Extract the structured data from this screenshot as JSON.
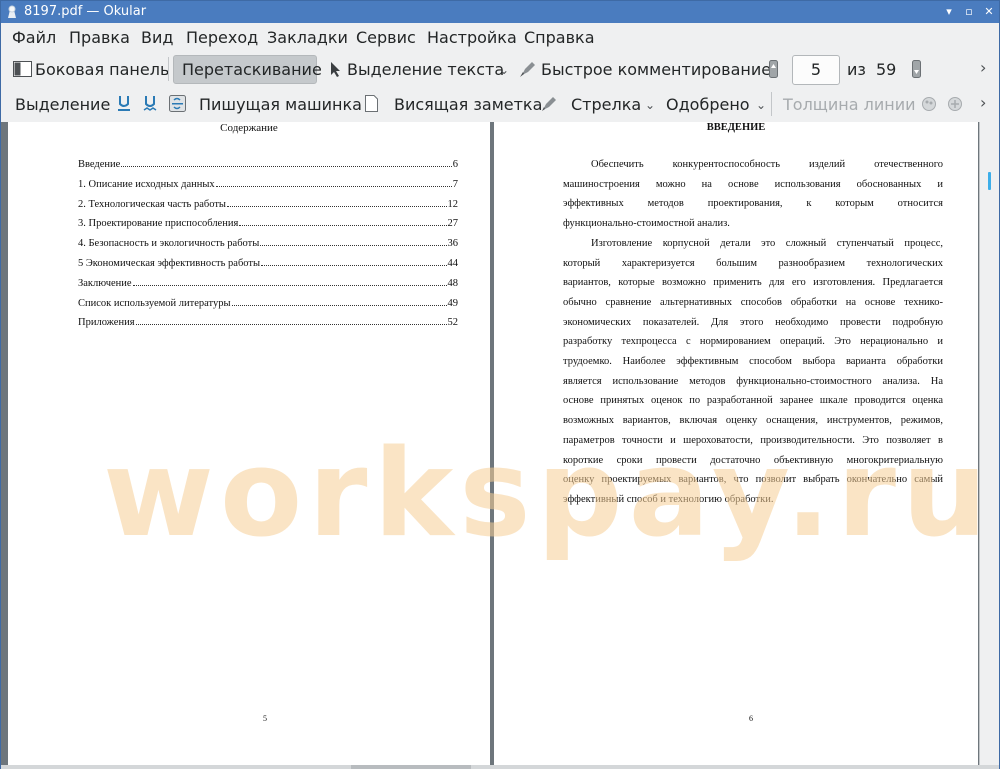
{
  "window": {
    "title": "8197.pdf  — Okular",
    "btn_minimize": "▾",
    "btn_maximize": "▫",
    "btn_close": "✕"
  },
  "menu": [
    "Файл",
    "Правка",
    "Вид",
    "Переход",
    "Закладки",
    "Сервис",
    "Настройка",
    "Справка"
  ],
  "toolbar1": {
    "sidebar": "Боковая панель",
    "drag": "Перетаскивание",
    "text_select": "Выделение текста",
    "quick_annot": "Быстрое комментирование",
    "page_current": "5",
    "page_of": "из",
    "page_total": "59"
  },
  "toolbar2": {
    "select": "Выделение",
    "typewriter": "Пишущая машинка",
    "hanging_note": "Висящая заметка",
    "arrow": "Стрелка",
    "approved": "Одобрено",
    "line_width": "Толщина линии"
  },
  "left_page": {
    "title": "Содержание",
    "toc": [
      {
        "label": "Введение",
        "page": "6"
      },
      {
        "label": "1. Описание  исходных данных",
        "page": "7"
      },
      {
        "label": "2. Технологическая часть работы",
        "page": "12"
      },
      {
        "label": "3. Проектирование приспособления",
        "page": "27"
      },
      {
        "label": "4. Безопасность и экологичность работы",
        "page": "36"
      },
      {
        "label": "5 Экономическая эффективность работы",
        "page": "44"
      },
      {
        "label": "Заключение",
        "page": "48"
      },
      {
        "label": "Список используемой литературы",
        "page": "49"
      },
      {
        "label": "Приложения",
        "page": "52"
      }
    ],
    "page_number": "5"
  },
  "right_page": {
    "title": "ВВЕДЕНИЕ",
    "lines": [
      "Обеспечить      конкурентоспособность      изделий      отечественного",
      "машиностроения можно на основе использования обоснованных и",
      "эффективных методов проектирования, к которым относится",
      "функционально-стоимостной анализ.",
      "Изготовление корпусной детали это сложный ступенчатый процесс,",
      "который характеризуется большим разнообразием технологических",
      "вариантов, которые возможно применить для его изготовления. Предлагается",
      "обычно сравнение альтернативных способов обработки на основе технико-",
      "экономических  показателей. Для этого необходимо провести подробную",
      "разработку техпроцесса с нормированием операций. Это нерационально и",
      "трудоемко. Наиболее эффективным способом выбора варианта обработки",
      "является использование методов функционально-стоимостного анализа. На",
      "основе принятых оценок по разработанной заранее шкале проводится оценка",
      "возможных вариантов, включая оценку оснащения, инструментов, режимов,",
      "параметров точности и шероховатости, производительности. Это позволяет в",
      "короткие сроки провести достаточно объективную многокритериальную",
      "оценку проектируемых вариантов, что позволит выбрать окончательно самый",
      "эффективный способ и технологию обработки."
    ],
    "page_number": "6"
  },
  "watermark": "workspay.ru"
}
